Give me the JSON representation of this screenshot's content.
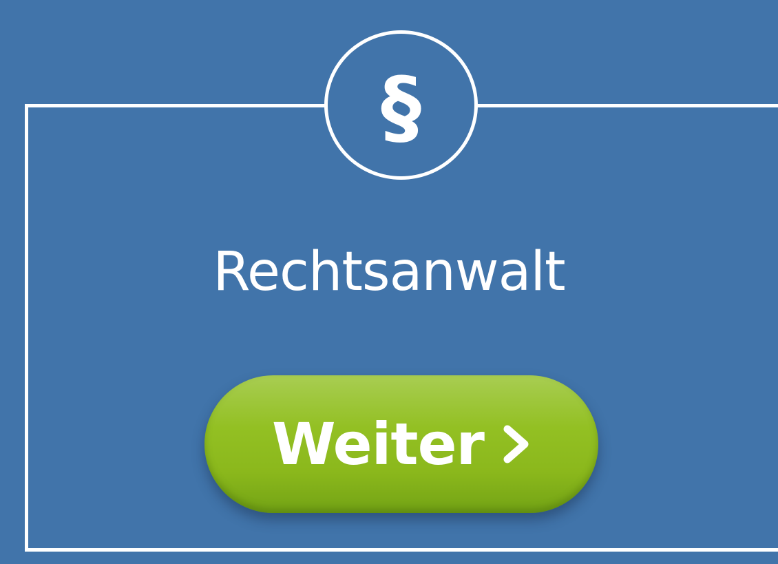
{
  "emblem": {
    "glyph": "§",
    "icon": "paragraph-section-icon"
  },
  "title": "Rechtsanwalt",
  "button": {
    "label": "Weiter",
    "icon": "chevron-right-icon"
  },
  "colors": {
    "background": "#4174aa",
    "frame": "#ffffff",
    "button": "#93c023",
    "text": "#ffffff"
  }
}
